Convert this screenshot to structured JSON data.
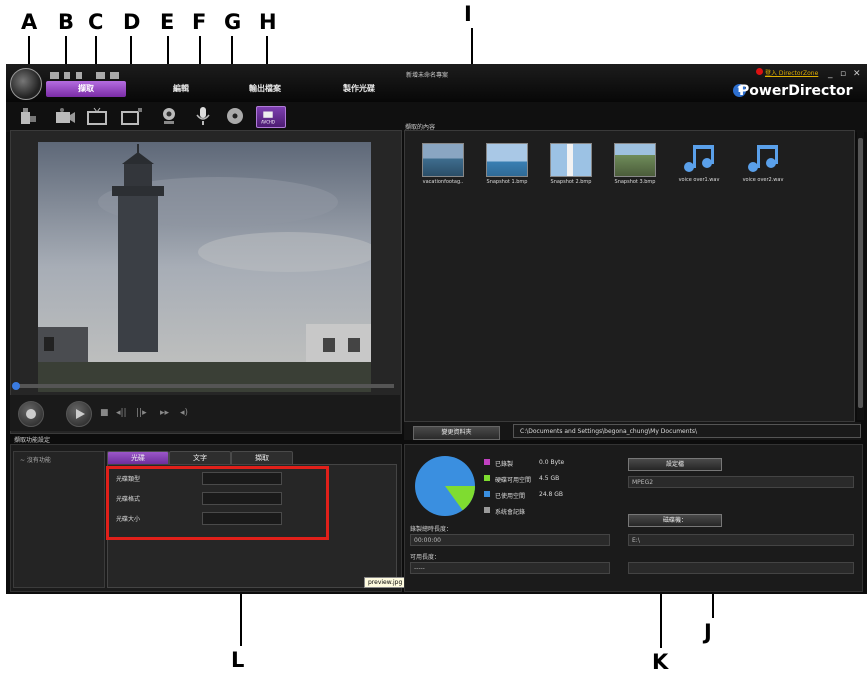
{
  "callouts": {
    "A": "A",
    "B": "B",
    "C": "C",
    "D": "D",
    "E": "E",
    "F": "F",
    "G": "G",
    "H": "H",
    "I": "I",
    "J": "J",
    "K": "K",
    "L": "L"
  },
  "window": {
    "project_title": "新增未命名專案",
    "directorzone_link": "登入 DirectorZone",
    "min": "_",
    "max": "▫",
    "close": "✕",
    "brand": "PowerDirector"
  },
  "main_tabs": [
    {
      "label": "擷取",
      "active": true
    },
    {
      "label": "編輯",
      "active": false
    },
    {
      "label": "輸出檔案",
      "active": false
    },
    {
      "label": "製作光碟",
      "active": false
    }
  ],
  "toolbar_icons": [
    {
      "name": "capture-from-dv-camcorder-icon"
    },
    {
      "name": "capture-from-hdv-camcorder-icon"
    },
    {
      "name": "capture-from-tv-icon"
    },
    {
      "name": "capture-from-digital-tv-icon"
    },
    {
      "name": "capture-from-webcam-icon"
    },
    {
      "name": "capture-from-microphone-icon"
    },
    {
      "name": "capture-from-cd-icon"
    },
    {
      "name": "capture-from-avchd-icon",
      "label": "AVCHD"
    }
  ],
  "library": {
    "label": "擷取的內容",
    "items": [
      {
        "caption": "vacationfootag..",
        "kind": "sea"
      },
      {
        "caption": "Snapshot 1.bmp",
        "kind": "sea2"
      },
      {
        "caption": "Snapshot 2.bmp",
        "kind": "lighthouse"
      },
      {
        "caption": "Snapshot 3.bmp",
        "kind": "people"
      },
      {
        "caption": "voice over1.wav",
        "kind": "audio"
      },
      {
        "caption": "voice over2.wav",
        "kind": "audio"
      }
    ]
  },
  "capture_folder": {
    "button": "變更資料夾",
    "path": "C:\\Documents and Settings\\begona_chung\\My Documents\\"
  },
  "capture_settings": {
    "label": "擷取功能設定",
    "options_item": "~ 沒有功能",
    "tabs": [
      {
        "label": "光碟",
        "active": true
      },
      {
        "label": "文字",
        "active": false
      },
      {
        "label": "擷取",
        "active": false
      }
    ],
    "fields": [
      {
        "label": "光碟類型",
        "value": ""
      },
      {
        "label": "光碟格式",
        "value": ""
      },
      {
        "label": "光碟大小",
        "value": ""
      }
    ],
    "tooltip": "preview.jpg - 小畫家"
  },
  "disk": {
    "legend": [
      {
        "label": "已錄製",
        "value": "0.0 Byte",
        "color": "#c040c0"
      },
      {
        "label": "硬碟可用空間",
        "value": "4.5 GB",
        "color": "#7fdc30"
      },
      {
        "label": "已使用空間",
        "value": "24.8 GB",
        "color": "#3a8fe0"
      },
      {
        "label": "系统會記錄",
        "value": "",
        "color": "#9a9a9a"
      }
    ],
    "pie_fractions": {
      "used": 0.85,
      "free": 0.15
    },
    "duration_label": "錄製總時長度：",
    "duration_value": "00:00:00",
    "available_label": "可用長度：",
    "available_value": "-----",
    "profile_button": "設定檔",
    "profile_value": "MPEG2",
    "drive_button": "磁碟機：",
    "drive_value": "E:\\"
  }
}
